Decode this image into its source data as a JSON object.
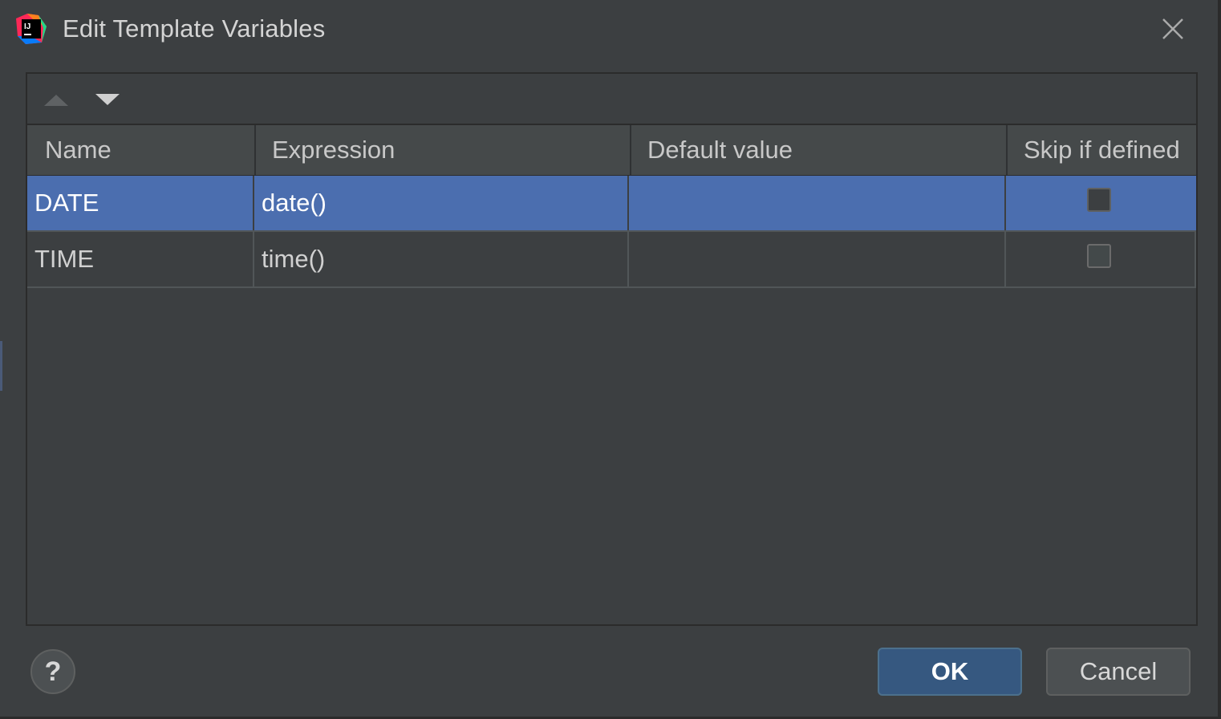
{
  "window": {
    "title": "Edit Template Variables",
    "app_icon": "intellij-idea-icon",
    "close_icon": "close-icon"
  },
  "toolbar": {
    "move_up_icon": "triangle-up-icon",
    "move_down_icon": "triangle-down-icon"
  },
  "table": {
    "columns": [
      "Name",
      "Expression",
      "Default value",
      "Skip if defined"
    ],
    "rows": [
      {
        "name": "DATE",
        "expression": "date()",
        "default_value": "",
        "skip_if_defined": false,
        "selected": true
      },
      {
        "name": "TIME",
        "expression": "time()",
        "default_value": "",
        "skip_if_defined": false,
        "selected": false
      }
    ]
  },
  "footer": {
    "help_label": "?",
    "ok_label": "OK",
    "cancel_label": "Cancel"
  },
  "colors": {
    "dialog_bg": "#3c3f41",
    "selection": "#4b6eaf",
    "ok_button": "#365880"
  }
}
